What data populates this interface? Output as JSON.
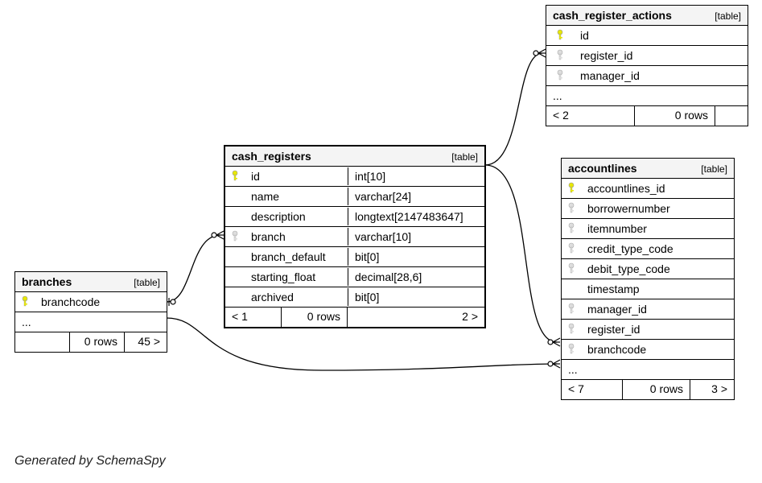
{
  "generated_by": "Generated by SchemaSpy",
  "tables": {
    "branches": {
      "name": "branches",
      "type": "[table]",
      "columns": [
        {
          "key": "pk",
          "name": "branchcode"
        }
      ],
      "ellipsis": "...",
      "footer": {
        "in": "",
        "rows": "0 rows",
        "out": "45 >"
      }
    },
    "cash_registers": {
      "name": "cash_registers",
      "type": "[table]",
      "columns": [
        {
          "key": "pk",
          "name": "id",
          "ctype": "int[10]"
        },
        {
          "key": "",
          "name": "name",
          "ctype": "varchar[24]"
        },
        {
          "key": "",
          "name": "description",
          "ctype": "longtext[2147483647]"
        },
        {
          "key": "fk",
          "name": "branch",
          "ctype": "varchar[10]"
        },
        {
          "key": "",
          "name": "branch_default",
          "ctype": "bit[0]"
        },
        {
          "key": "",
          "name": "starting_float",
          "ctype": "decimal[28,6]"
        },
        {
          "key": "",
          "name": "archived",
          "ctype": "bit[0]"
        }
      ],
      "footer": {
        "in": "< 1",
        "rows": "0 rows",
        "out": "2 >"
      }
    },
    "cash_register_actions": {
      "name": "cash_register_actions",
      "type": "[table]",
      "columns": [
        {
          "key": "pk",
          "name": "id"
        },
        {
          "key": "fk",
          "name": "register_id"
        },
        {
          "key": "fk",
          "name": "manager_id"
        }
      ],
      "ellipsis": "...",
      "footer": {
        "in": "< 2",
        "rows": "0 rows",
        "out": ""
      }
    },
    "accountlines": {
      "name": "accountlines",
      "type": "[table]",
      "columns": [
        {
          "key": "pk",
          "name": "accountlines_id"
        },
        {
          "key": "fk",
          "name": "borrowernumber"
        },
        {
          "key": "fk",
          "name": "itemnumber"
        },
        {
          "key": "fk",
          "name": "credit_type_code"
        },
        {
          "key": "fk",
          "name": "debit_type_code"
        },
        {
          "key": "",
          "name": "timestamp"
        },
        {
          "key": "fk",
          "name": "manager_id"
        },
        {
          "key": "fk",
          "name": "register_id"
        },
        {
          "key": "fk",
          "name": "branchcode"
        }
      ],
      "ellipsis": "...",
      "footer": {
        "in": "< 7",
        "rows": "0 rows",
        "out": "3 >"
      }
    }
  },
  "relations": [
    {
      "from": "branches.branchcode",
      "to": "cash_registers.branch"
    },
    {
      "from": "cash_registers.id",
      "to": "cash_register_actions.register_id"
    },
    {
      "from": "cash_registers.id",
      "to": "accountlines.register_id"
    },
    {
      "from": "branches.branchcode",
      "to": "accountlines.branchcode"
    }
  ]
}
